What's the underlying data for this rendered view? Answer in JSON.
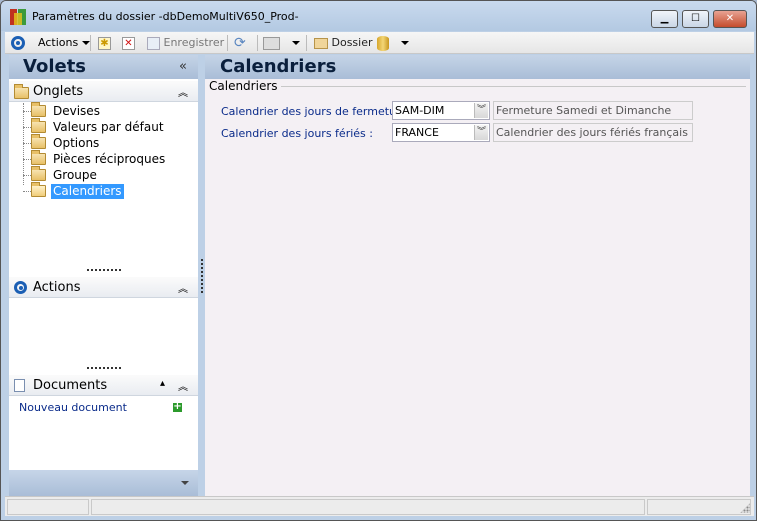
{
  "window": {
    "title": "Paramètres du dossier -dbDemoMultiV650_Prod-",
    "controls": {
      "minimize": "▁",
      "maximize": "☐",
      "close": "✕"
    }
  },
  "toolbar": {
    "actions_label": "Actions",
    "save_label": "Enregistrer",
    "folder_label": "Dossier"
  },
  "left_panel": {
    "title": "Volets",
    "collapse_symbol": "«",
    "onglets": {
      "label": "Onglets",
      "chevron": "⌃",
      "items": [
        {
          "label": "Devises"
        },
        {
          "label": "Valeurs par défaut"
        },
        {
          "label": "Options"
        },
        {
          "label": "Pièces réciproques"
        },
        {
          "label": "Groupe"
        },
        {
          "label": "Calendriers",
          "selected": true
        }
      ]
    },
    "actions": {
      "label": "Actions",
      "chevron": "⌃"
    },
    "documents": {
      "label": "Documents",
      "chevron": "⌃",
      "new_document": "Nouveau document"
    }
  },
  "main": {
    "title": "Calendriers",
    "group_label": "Calendriers",
    "rows": [
      {
        "label": "Calendrier des jours de fermeture :",
        "value": "SAM-DIM",
        "description": "Fermeture Samedi et  Dimanche"
      },
      {
        "label": "Calendrier des jours fériés :",
        "value": "FRANCE",
        "description": "Calendrier des jours fériés français"
      }
    ]
  },
  "icons": {
    "app": "app-icon",
    "actions": "ring-icon",
    "new": "new-icon",
    "delete": "delete-icon",
    "save": "save-icon",
    "refresh": "refresh-icon",
    "print": "print-icon",
    "folder": "folder-icon",
    "database": "database-icon"
  },
  "colors": {
    "selection": "#3399ff",
    "link": "#0a2b8a",
    "header_gradient_top": "#c5d4e7",
    "header_gradient_bottom": "#a9bdd7"
  }
}
